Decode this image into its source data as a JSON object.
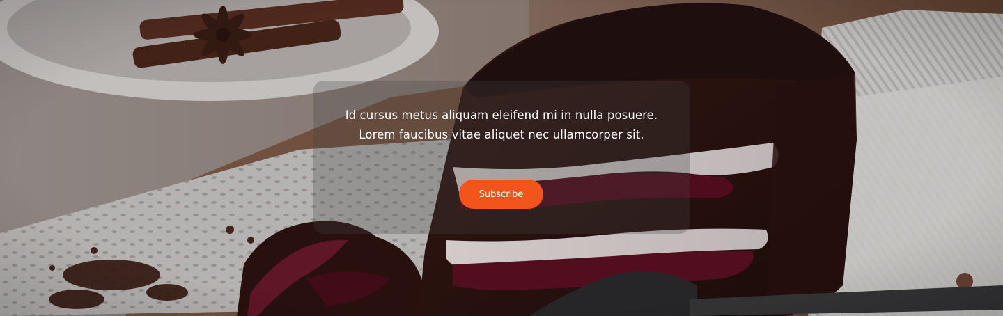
{
  "hero": {
    "tagline_line1": "Id cursus metus aliquam eleifend mi in nulla posuere.",
    "tagline_line2": "Lorem faucibus vitae aliquet nec ullamcorper sit.",
    "subscribe_label": "Subscribe"
  },
  "colors": {
    "accent": "#f2541b",
    "text": "#ffffff"
  },
  "background_image": "chocolate-cherry-cake-slice"
}
